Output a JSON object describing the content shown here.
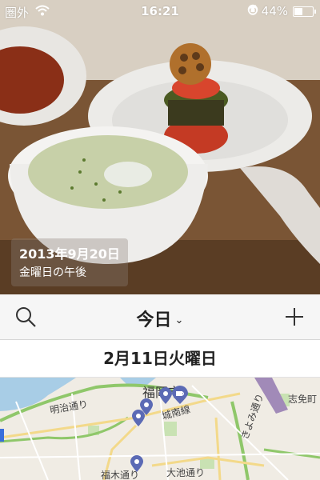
{
  "status": {
    "carrier": "圏外",
    "time": "16:21",
    "battery": "44%",
    "battery_level": 0.44
  },
  "photo": {
    "date": "2013年9月20日",
    "subtitle": "金曜日の午後"
  },
  "toolbar": {
    "title": "今日",
    "chevron": "⌄"
  },
  "section": {
    "header": "2月11日火曜日"
  },
  "map": {
    "labels": {
      "fukuoka": "福岡市",
      "shimenmachi": "志免町",
      "meiji": "明治通り",
      "shirokanemachi": "城南線",
      "kiyomi": "きよみ通り",
      "fukugi": "福木通り",
      "oike": "大池通り"
    },
    "colors": {
      "land": "#f0ece4",
      "water": "#a8cde6",
      "park": "#c9e2b3",
      "expressway": "#8fc76a",
      "road": "#f3d98a",
      "pin": "#5b6ab5"
    }
  }
}
